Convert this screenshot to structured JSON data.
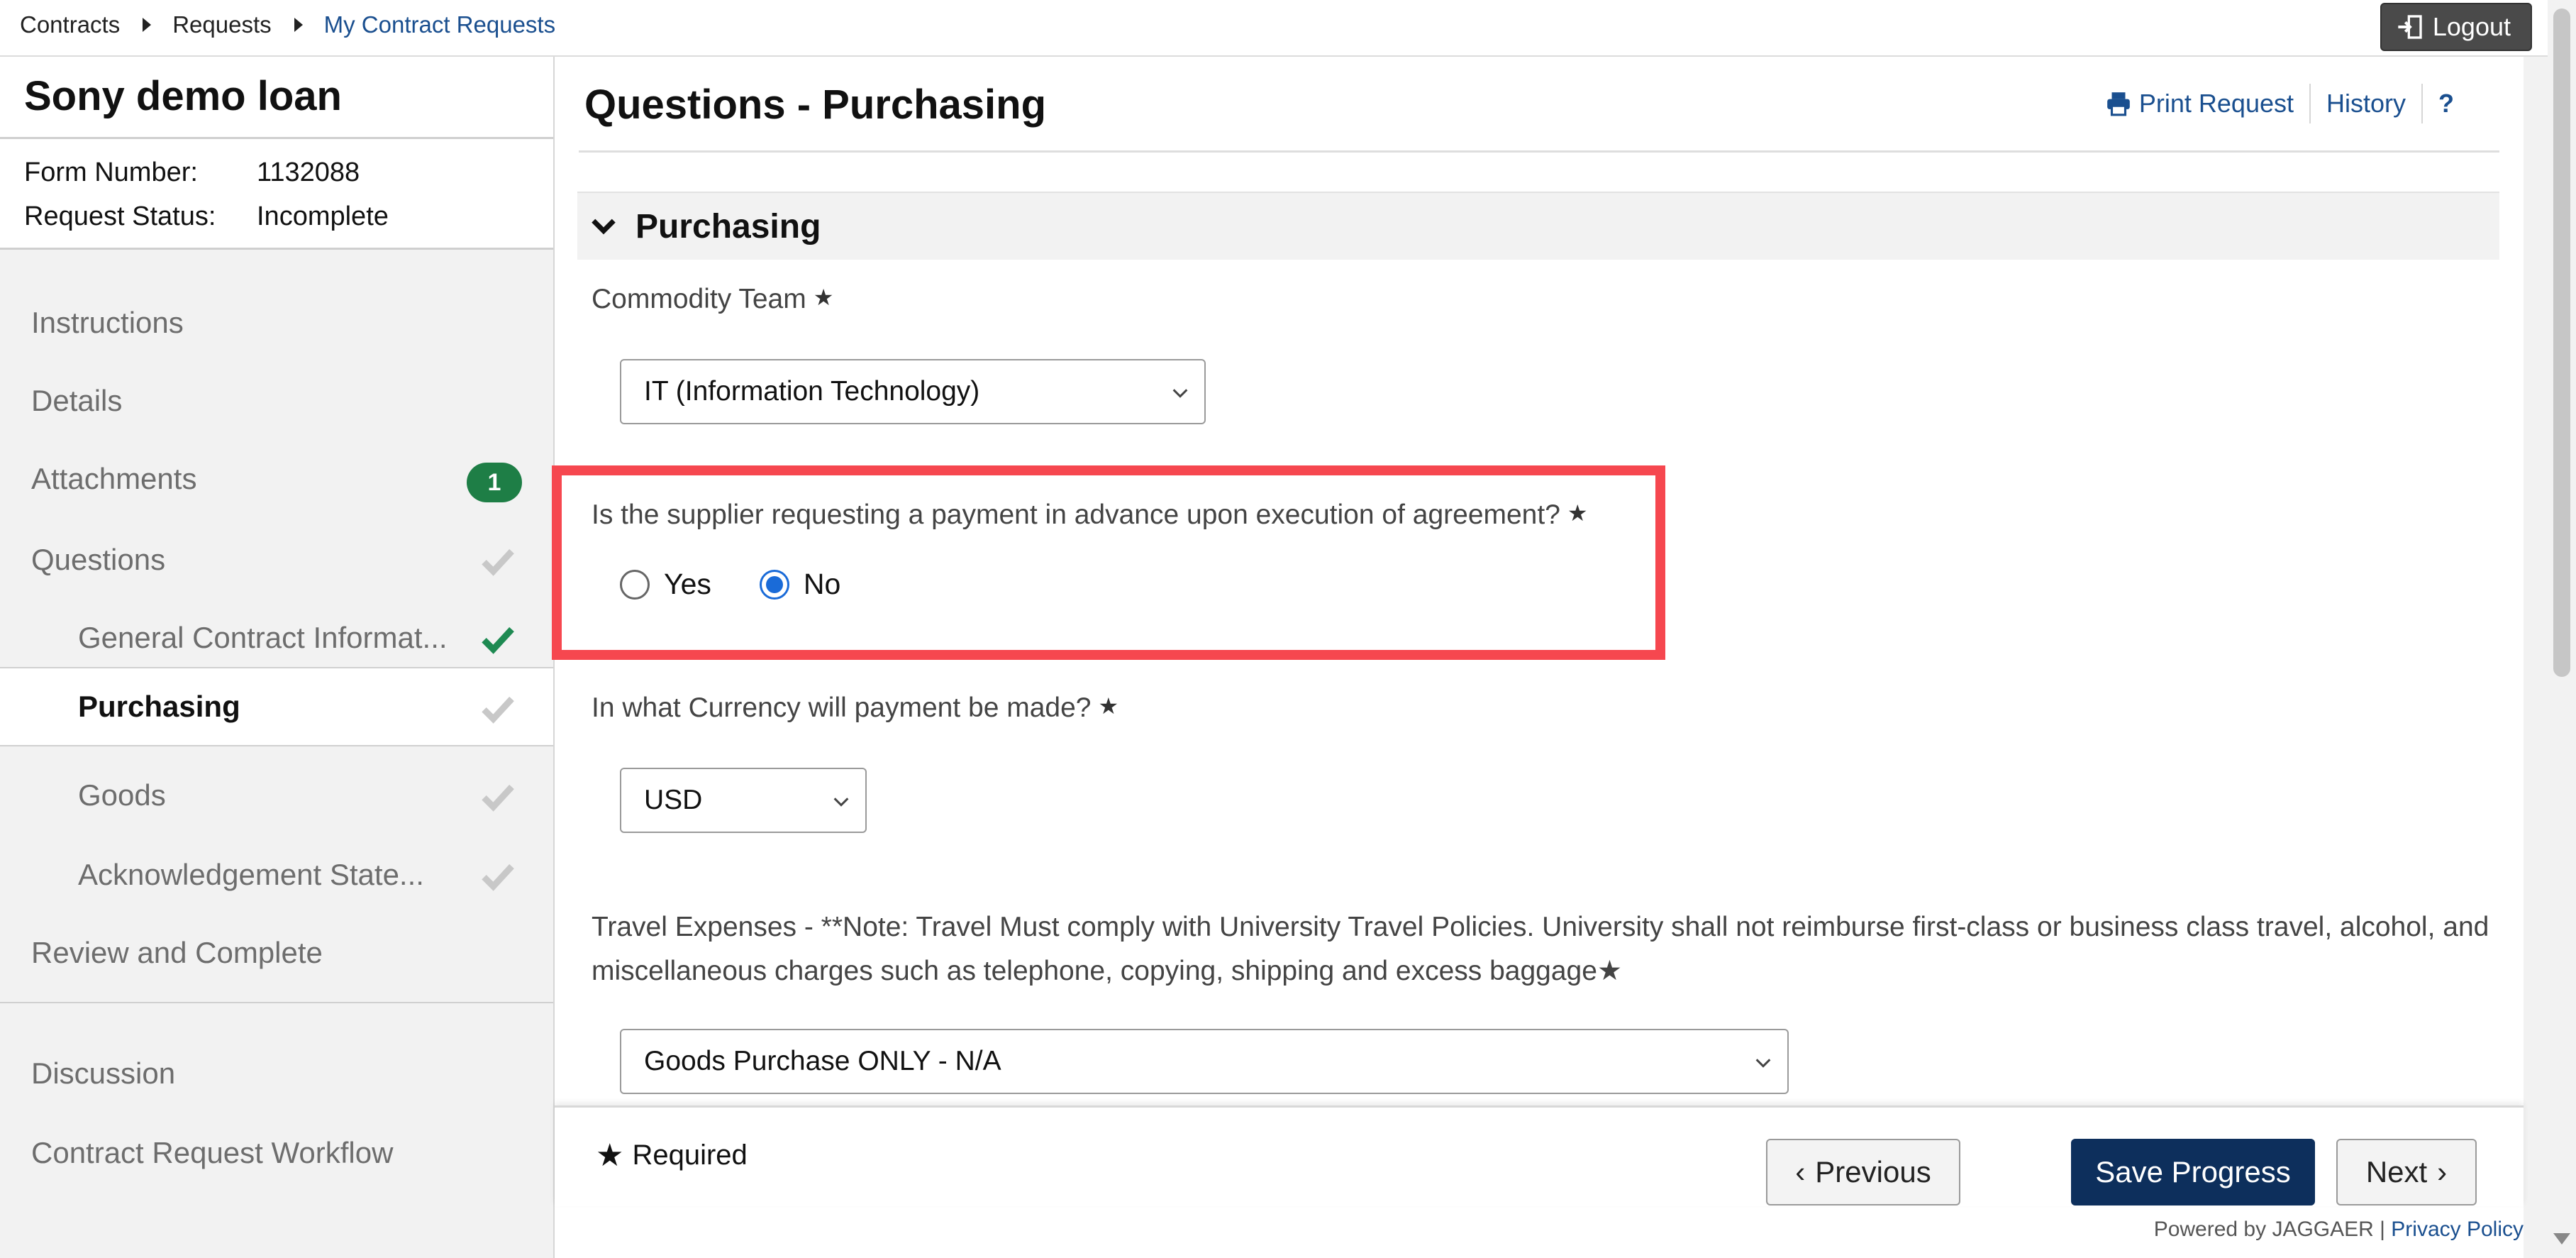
{
  "breadcrumb": {
    "items": [
      "Contracts",
      "Requests",
      "My Contract Requests"
    ]
  },
  "header": {
    "logout_label": "Logout"
  },
  "sidebar": {
    "title": "Sony demo loan",
    "form_number_label": "Form Number:",
    "form_number_value": "1132088",
    "status_label": "Request Status:",
    "status_value": "Incomplete",
    "items": [
      {
        "label": "Instructions"
      },
      {
        "label": "Details"
      },
      {
        "label": "Attachments",
        "badge": "1"
      },
      {
        "label": "Questions",
        "check": "grey"
      },
      {
        "label": "General Contract Informat...",
        "check": "green"
      },
      {
        "label": "Purchasing",
        "check": "grey",
        "active": true
      },
      {
        "label": "Goods",
        "check": "grey"
      },
      {
        "label": "Acknowledgement State...",
        "check": "grey"
      },
      {
        "label": "Review and Complete"
      },
      {
        "label": "Discussion"
      },
      {
        "label": "Contract Request Workflow"
      }
    ]
  },
  "main": {
    "title": "Questions - Purchasing",
    "print_label": "Print Request",
    "history_label": "History",
    "help_label": "?",
    "section_title": "Purchasing",
    "commodity": {
      "label": "Commodity Team",
      "value": "IT (Information Technology)"
    },
    "advance_payment": {
      "label": "Is the supplier requesting a payment in advance upon execution of agreement?",
      "options": [
        "Yes",
        "No"
      ],
      "selected": "No"
    },
    "currency": {
      "label": "In what Currency will payment be made?",
      "value": "USD"
    },
    "travel": {
      "label": "Travel Expenses - **Note: Travel Must comply with University Travel Policies. University shall not reimburse first-class or business class travel, alcohol, and miscellaneous charges such as telephone, copying, shipping and excess baggage",
      "value": "Goods Purchase ONLY - N/A"
    },
    "required_star": "★"
  },
  "footer": {
    "required_label": "Required",
    "previous_label": "Previous",
    "save_label": "Save Progress",
    "next_label": "Next",
    "powered_by": "Powered by JAGGAER |",
    "privacy_label": "Privacy Policy"
  },
  "colors": {
    "brand_navy": "#0d2f5c",
    "link_blue": "#1a4f8f",
    "highlight_red": "#f6474f",
    "success_green": "#1e7e46"
  }
}
